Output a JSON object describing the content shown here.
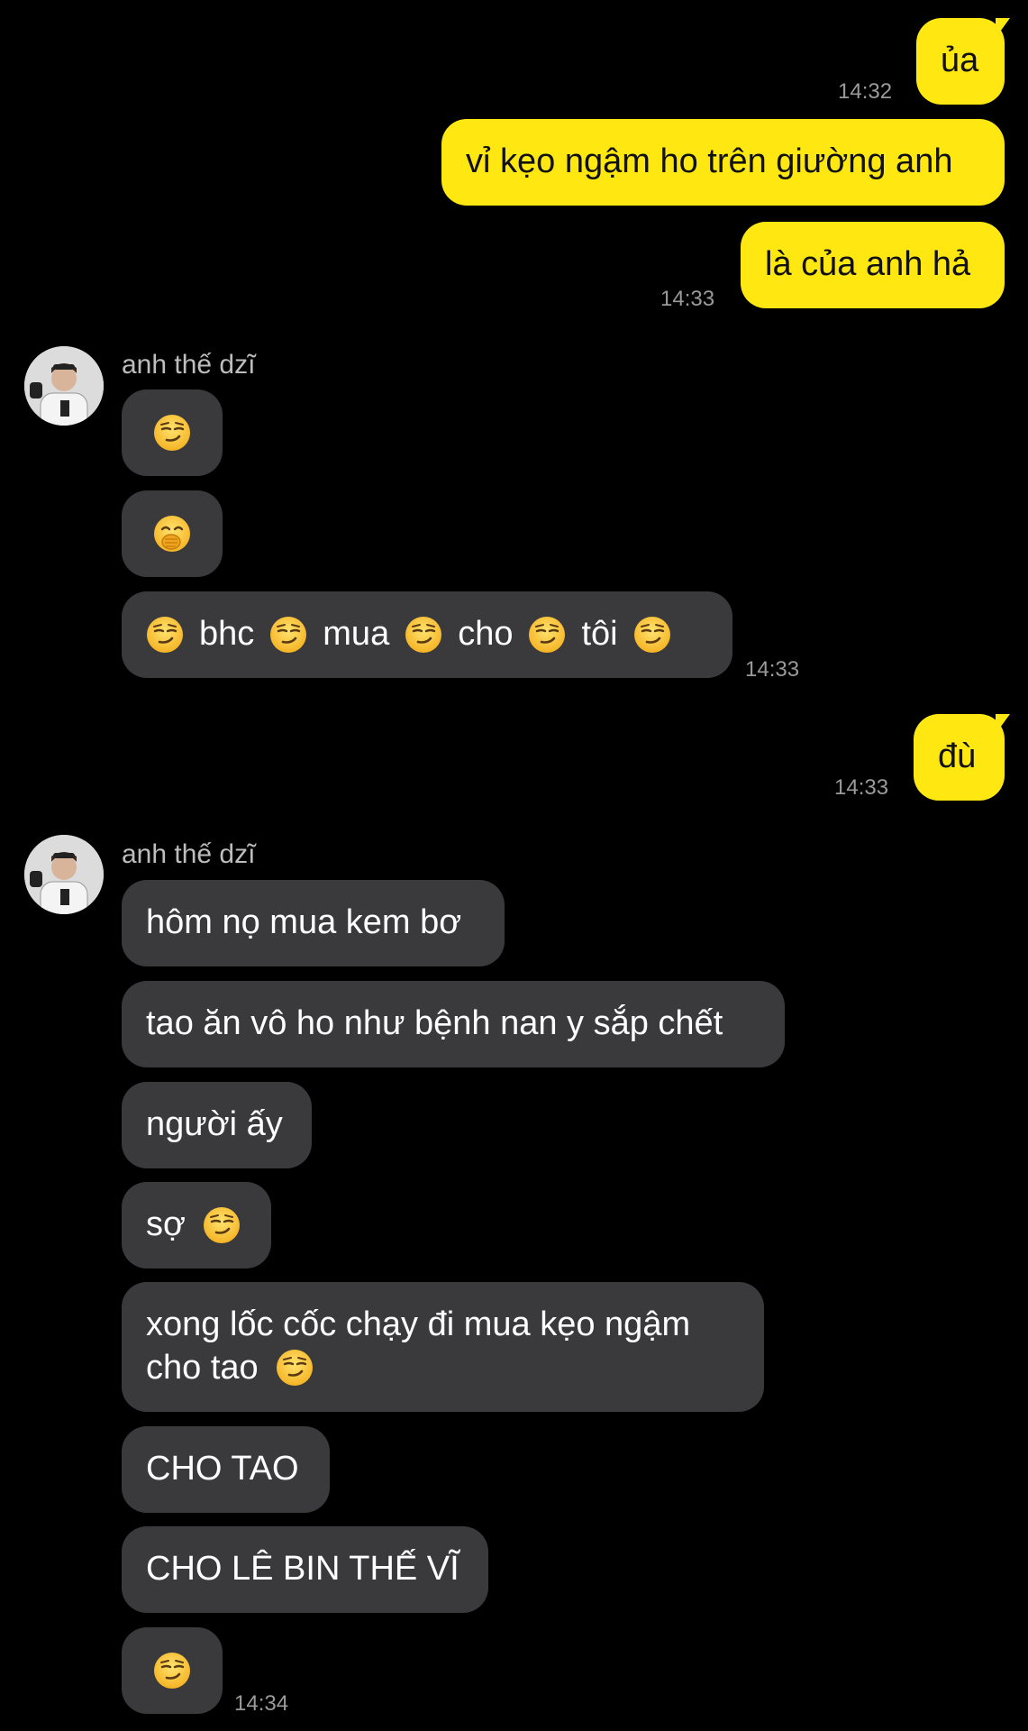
{
  "colors": {
    "background": "#000000",
    "outgoing_bubble": "#FFE812",
    "incoming_bubble": "#3A3A3C",
    "timestamp": "#9A9A9A"
  },
  "messages": {
    "out1": {
      "text": "ủa",
      "time": "14:32"
    },
    "out2": {
      "text": "vỉ kẹo ngậm ho trên giường anh"
    },
    "out3": {
      "text": "là của anh hả",
      "time": "14:33"
    },
    "group1": {
      "sender": "anh thế dzĩ",
      "avatar_icon": "profile-photo-icon",
      "emoji1": "smirking-face-icon",
      "emoji2": "face-with-hand-over-mouth-icon",
      "combo": {
        "w1": "bhc",
        "w2": "mua",
        "w3": "cho",
        "w4": "tôi"
      },
      "time": "14:33"
    },
    "out4": {
      "text": "đù",
      "time": "14:33"
    },
    "group2": {
      "sender": "anh thế dzĩ",
      "m1": "hôm nọ mua kem bơ",
      "m2": "tao ăn vô ho như bệnh nan y sắp chết",
      "m3": "người ấy",
      "m4": "sợ",
      "m5_line1": "xong lốc cốc chạy đi mua kẹo ngậm",
      "m5_line2": "cho tao",
      "m6": "CHO TAO",
      "m7": "CHO LÊ BIN THẾ VĨ",
      "time": "14:34"
    }
  }
}
